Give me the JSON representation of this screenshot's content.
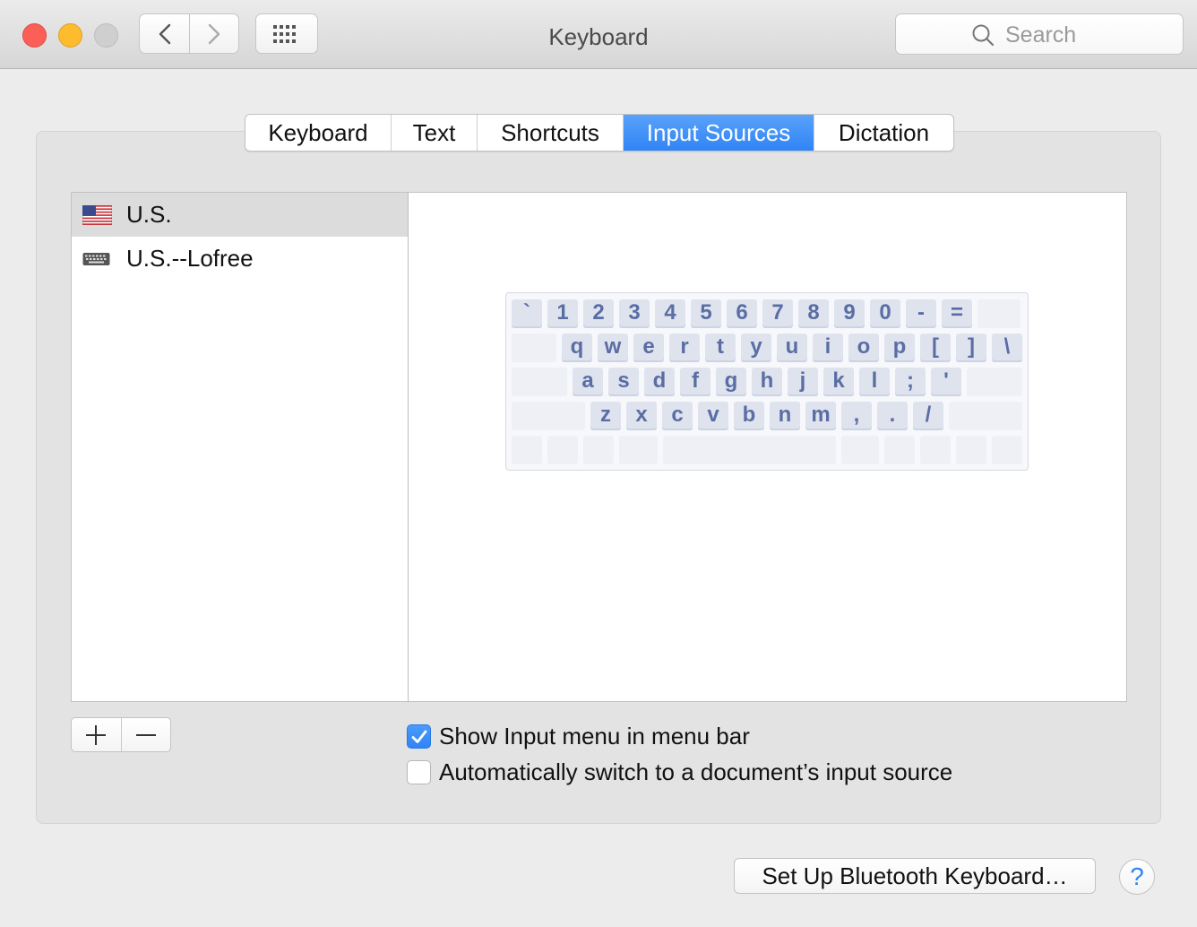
{
  "window": {
    "title": "Keyboard"
  },
  "search": {
    "placeholder": "Search"
  },
  "tabs": [
    {
      "label": "Keyboard",
      "active": false
    },
    {
      "label": "Text",
      "active": false
    },
    {
      "label": "Shortcuts",
      "active": false
    },
    {
      "label": "Input Sources",
      "active": true
    },
    {
      "label": "Dictation",
      "active": false
    }
  ],
  "sources": [
    {
      "label": "U.S.",
      "icon": "us-flag-icon",
      "selected": true
    },
    {
      "label": "U.S.--Lofree",
      "icon": "keyboard-icon",
      "selected": false
    }
  ],
  "keyboard_viewer": {
    "rows": [
      [
        "`",
        "1",
        "2",
        "3",
        "4",
        "5",
        "6",
        "7",
        "8",
        "9",
        "0",
        "-",
        "="
      ],
      [
        "q",
        "w",
        "e",
        "r",
        "t",
        "y",
        "u",
        "i",
        "o",
        "p",
        "[",
        "]",
        "\\"
      ],
      [
        "a",
        "s",
        "d",
        "f",
        "g",
        "h",
        "j",
        "k",
        "l",
        ";",
        "'"
      ],
      [
        "z",
        "x",
        "c",
        "v",
        "b",
        "n",
        "m",
        ",",
        ".",
        "/"
      ]
    ]
  },
  "options": {
    "show_input_menu": {
      "label": "Show Input menu in menu bar",
      "checked": true
    },
    "auto_switch": {
      "label": "Automatically switch to a document’s input source",
      "checked": false
    }
  },
  "buttons": {
    "bluetooth": "Set Up Bluetooth Keyboard…",
    "help": "?"
  },
  "colors": {
    "accent": "#2f84f5",
    "key_text": "#5a6da4"
  }
}
